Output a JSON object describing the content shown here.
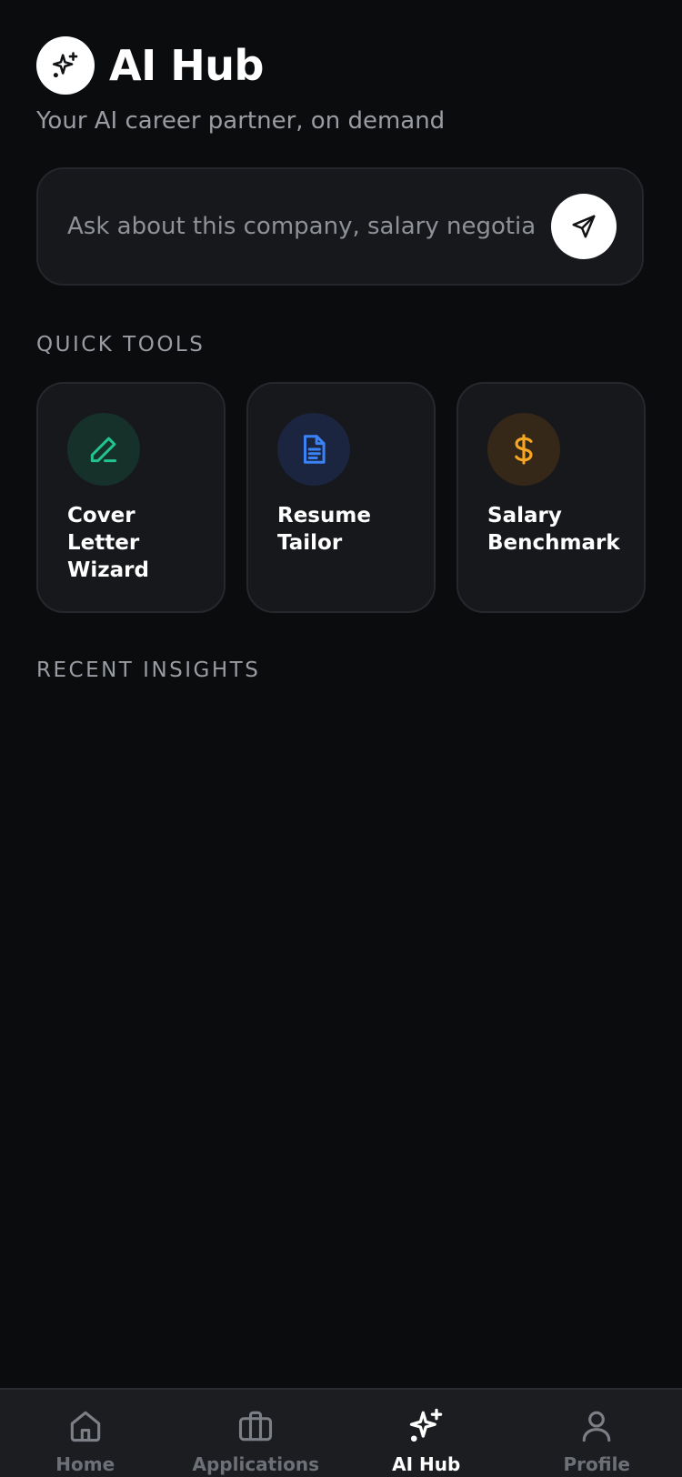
{
  "header": {
    "title": "AI Hub",
    "subtitle": "Your AI career partner, on demand",
    "logo_icon": "sparkles-icon"
  },
  "ask": {
    "placeholder": "Ask about this company, salary negotiat",
    "value": "",
    "send_icon": "send-icon"
  },
  "quick_tools": {
    "label": "QUICK TOOLS",
    "items": [
      {
        "label": "Cover\nLetter\nWizard",
        "icon": "pencil-icon",
        "color": "#22c38e"
      },
      {
        "label": "Resume\nTailor",
        "icon": "document-icon",
        "color": "#3b82f6"
      },
      {
        "label": "Salary\nBenchmark",
        "icon": "dollar-icon",
        "color": "#f5a623"
      }
    ]
  },
  "recent_insights": {
    "label": "RECENT INSIGHTS"
  },
  "nav": {
    "items": [
      {
        "label": "Home",
        "icon": "home-icon",
        "active": false
      },
      {
        "label": "Applications",
        "icon": "briefcase-icon",
        "active": false
      },
      {
        "label": "AI Hub",
        "icon": "sparkles-icon",
        "active": true
      },
      {
        "label": "Profile",
        "icon": "user-icon",
        "active": false
      }
    ]
  },
  "colors": {
    "background": "#0b0c0e",
    "card": "#17181c",
    "muted_text": "#9a9ca3",
    "nav_inactive": "#6e7077"
  }
}
